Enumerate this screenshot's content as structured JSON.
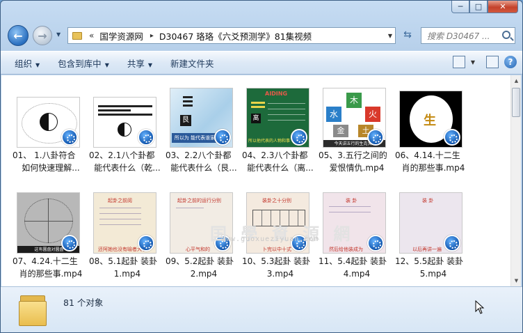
{
  "window": {
    "caption_buttons": {
      "minimize": "─",
      "maximize": "□",
      "close": "✕"
    }
  },
  "nav": {
    "back_glyph": "←",
    "forward_glyph": "→",
    "dropdown_glyph": "▼",
    "breadcrumb": {
      "overflow": "«",
      "items": [
        "国学资源网",
        "D30467 珞珞《六爻预测学》81集视频"
      ],
      "separator": "▸"
    },
    "refresh_glyph": "⇆",
    "search_placeholder": "搜索 D30467 ..."
  },
  "toolbar": {
    "items": [
      {
        "label": "组织",
        "has_dropdown": true
      },
      {
        "label": "包含到库中",
        "has_dropdown": true
      },
      {
        "label": "共享",
        "has_dropdown": true
      },
      {
        "label": "新建文件夹",
        "has_dropdown": false
      }
    ],
    "dropdown_glyph": "▼",
    "help_glyph": "?"
  },
  "files": [
    {
      "line1": "01、 1.八卦符合",
      "line2": "如何快速理解...",
      "thumb": "bagua-white"
    },
    {
      "line1": "02、2.1八个卦都",
      "line2": "能代表什么（乾...",
      "thumb": "bagua-list"
    },
    {
      "line1": "03、2.2八个卦都",
      "line2": "能代表什么（艮...",
      "thumb": "sky"
    },
    {
      "line1": "04、2.3八个卦都",
      "line2": "能代表什么（离...",
      "thumb": "green-slide"
    },
    {
      "line1": "05、3.五行之间的",
      "line2": "爱恨情仇.mp4",
      "thumb": "wuxing"
    },
    {
      "line1": "06、4.14.十二生",
      "line2": "肖的那些事.mp4",
      "thumb": "zodiac"
    },
    {
      "line1": "07、4.24.十二生",
      "line2": "肖的那些事.mp4",
      "thumb": "compass"
    },
    {
      "line1": "08、5.1起卦 装卦",
      "line2": "1.mp4",
      "thumb": "paper"
    },
    {
      "line1": "09、5.2起卦 装卦",
      "line2": "2.mp4",
      "thumb": "paper"
    },
    {
      "line1": "10、5.3起卦 装卦",
      "line2": "3.mp4",
      "thumb": "paper-table"
    },
    {
      "line1": "11、5.4起卦 装卦",
      "line2": "4.mp4",
      "thumb": "pink"
    },
    {
      "line1": "12、5.5起卦 装卦",
      "line2": "5.mp4",
      "thumb": "lilac"
    }
  ],
  "thumb_text": {
    "t3_char": "艮",
    "t3_caption": "所以为 能代表谁家",
    "t4_title": "AIDING",
    "t4_char": "离",
    "t4_caption": "所以他代表的人物和事",
    "t5_elements": [
      "木",
      "火",
      "土",
      "金",
      "水"
    ],
    "t5_caption": "今天讲五行的生克关系",
    "t6_center": "生",
    "t7_caption": "这有圆盘对圆盘",
    "t8_title": "起卦之前阅",
    "t8_caption": "还阿她也没有喻者大了",
    "t9_title": "起卦之前的运行分别",
    "t9_caption": "心平气和的",
    "t10_title": "装卦之十分别",
    "t10_caption": "卜完以中十式",
    "t11_title": "装  卦",
    "t11_caption": "然后给他装成为",
    "t12_title": "装  卦",
    "t12_caption": "以后再讲一遍"
  },
  "watermark": {
    "text": "www.guoxueziyuan.com",
    "big": "国 學 資 源 網"
  },
  "status": {
    "count_text": "81 个对象"
  },
  "colors": {
    "accent": "#2a6fbf",
    "badge": "#0a4fa8",
    "close": "#c4422b"
  }
}
